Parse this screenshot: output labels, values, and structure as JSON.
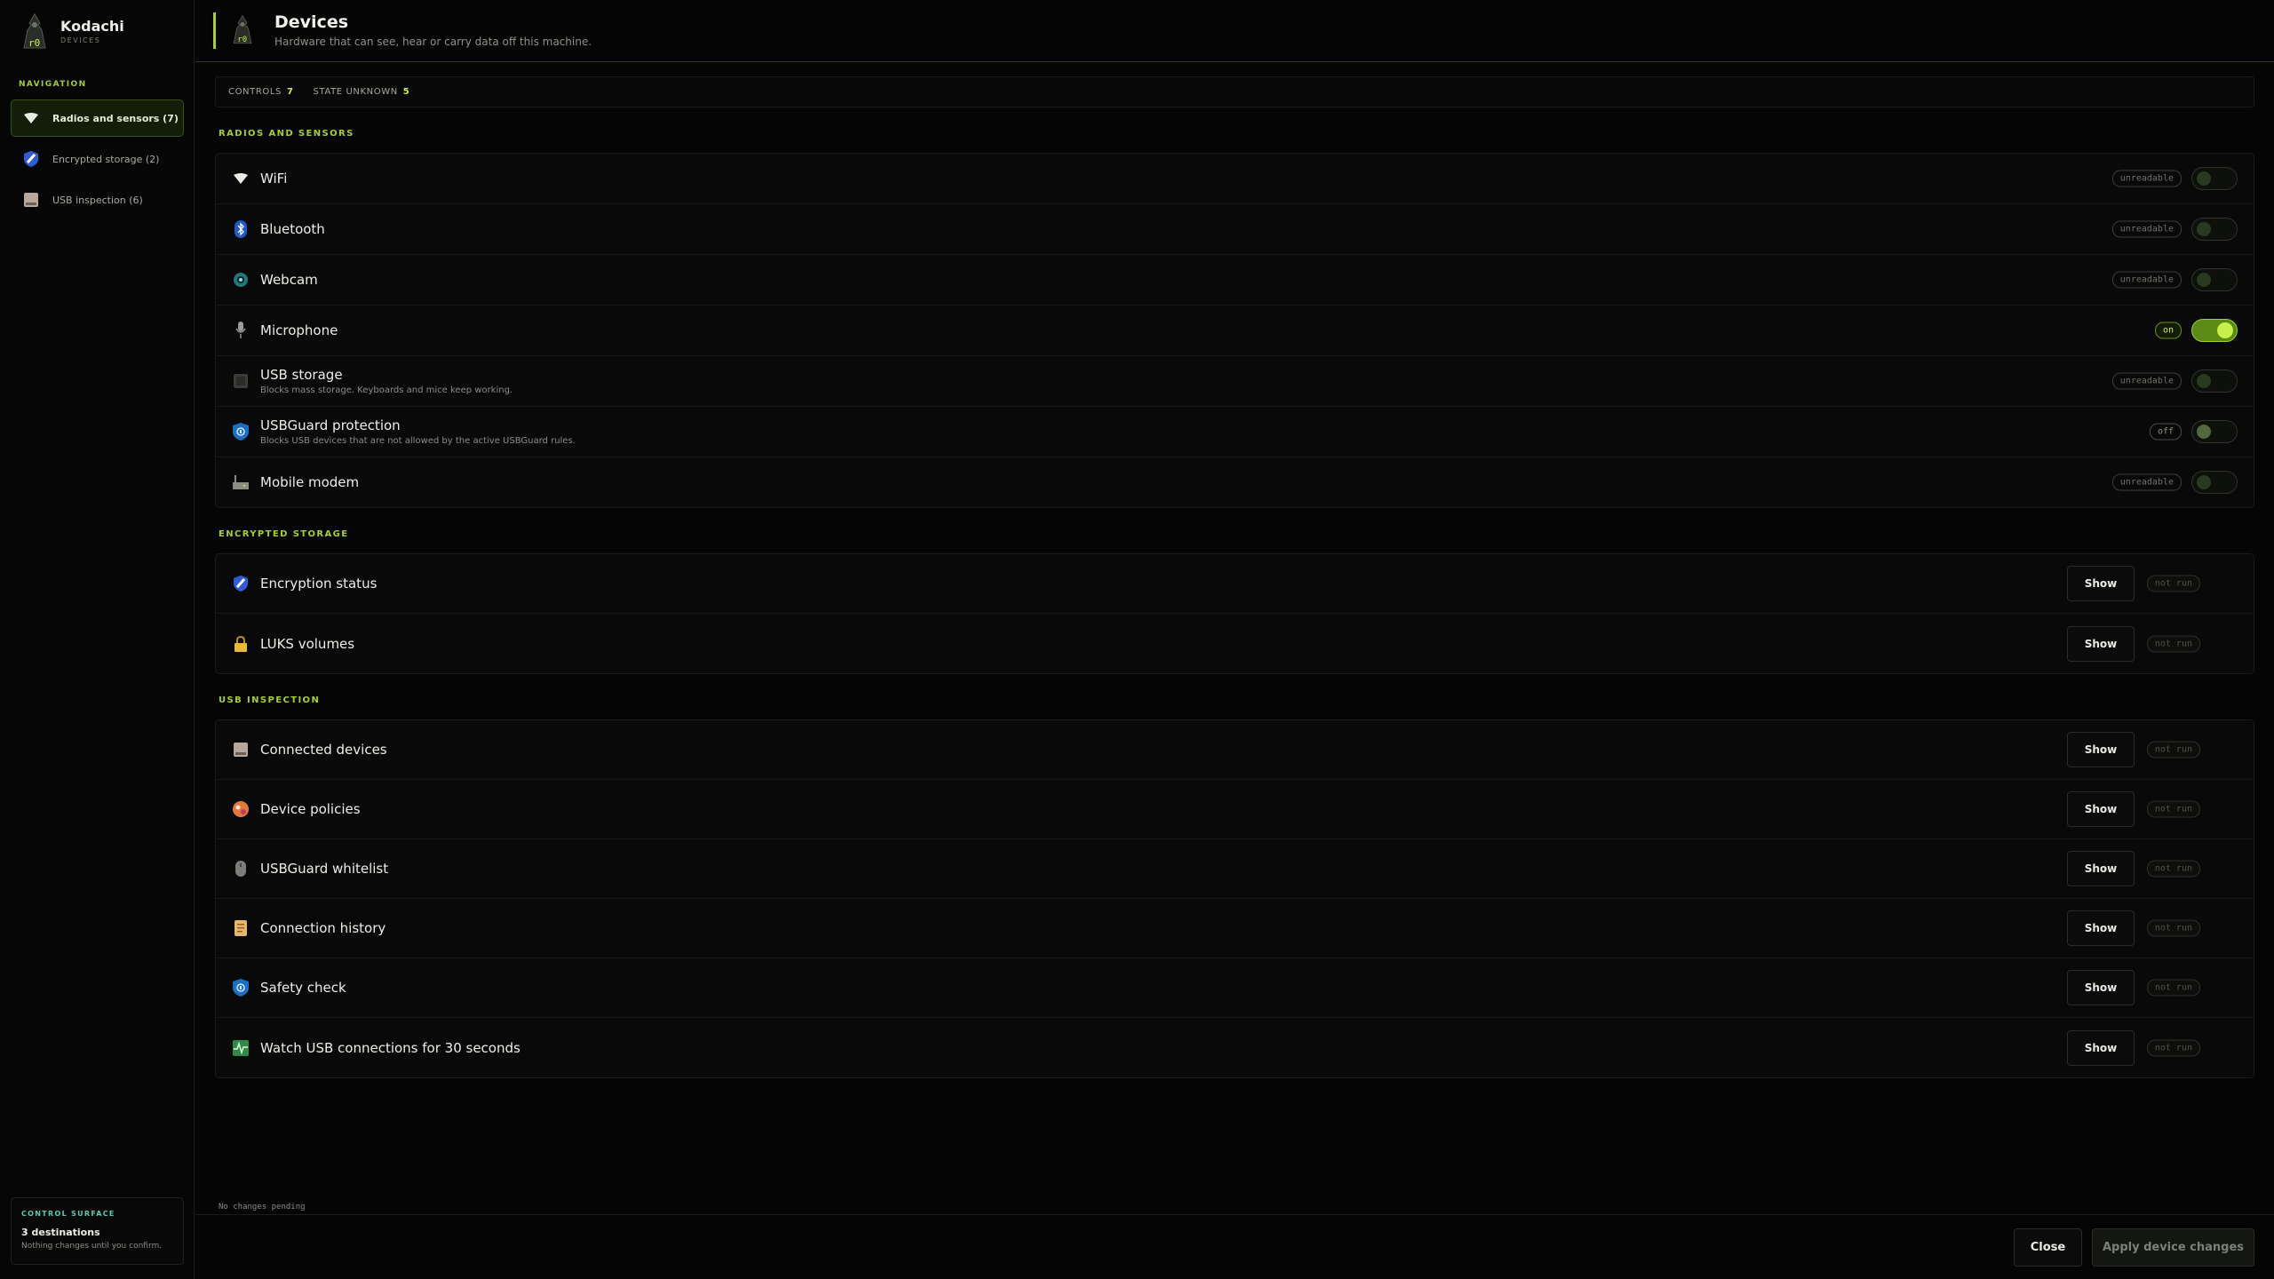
{
  "app": {
    "name": "Kodachi",
    "subtitle": "DEVICES"
  },
  "sidebar": {
    "heading": "NAVIGATION",
    "items": [
      {
        "label": "Radios and sensors (7)",
        "icon": "wifi-icon",
        "active": true
      },
      {
        "label": "Encrypted storage (2)",
        "icon": "shield-icon",
        "active": false
      },
      {
        "label": "USB inspection (6)",
        "icon": "drive-icon",
        "active": false
      }
    ],
    "control_surface": {
      "heading": "CONTROL SURFACE",
      "title": "3 destinations",
      "subtitle": "Nothing changes until you confirm."
    }
  },
  "header": {
    "title": "Devices",
    "subtitle": "Hardware that can see, hear or carry data off this machine."
  },
  "stats": {
    "controls_label": "CONTROLS",
    "controls_value": "7",
    "unknown_label": "STATE UNKNOWN",
    "unknown_value": "5"
  },
  "radios": {
    "title": "RADIOS AND SENSORS",
    "rows": [
      {
        "label": "WiFi",
        "status": "unreadable",
        "icon": "wifi-icon"
      },
      {
        "label": "Bluetooth",
        "status": "unreadable",
        "icon": "bluetooth-icon"
      },
      {
        "label": "Webcam",
        "status": "unreadable",
        "icon": "webcam-icon"
      },
      {
        "label": "Microphone",
        "status": "on",
        "icon": "microphone-icon"
      },
      {
        "label": "USB storage",
        "desc": "Blocks mass storage. Keyboards and mice keep working.",
        "status": "unreadable",
        "icon": "usb-storage-icon"
      },
      {
        "label": "USBGuard protection",
        "desc": "Blocks USB devices that are not allowed by the active USBGuard rules.",
        "status": "off",
        "icon": "shield-lock-icon"
      },
      {
        "label": "Mobile modem",
        "status": "unreadable",
        "icon": "modem-icon"
      }
    ]
  },
  "encrypted": {
    "title": "ENCRYPTED STORAGE",
    "rows": [
      {
        "label": "Encryption status",
        "button": "Show",
        "status": "not run",
        "icon": "shield-icon"
      },
      {
        "label": "LUKS volumes",
        "button": "Show",
        "status": "not run",
        "icon": "lock-icon"
      }
    ]
  },
  "usb": {
    "title": "USB INSPECTION",
    "rows": [
      {
        "label": "Connected devices",
        "button": "Show",
        "status": "not run",
        "icon": "drive-icon"
      },
      {
        "label": "Device policies",
        "button": "Show",
        "status": "not run",
        "icon": "policy-icon"
      },
      {
        "label": "USBGuard whitelist",
        "button": "Show",
        "status": "not run",
        "icon": "mouse-icon"
      },
      {
        "label": "Connection history",
        "button": "Show",
        "status": "not run",
        "icon": "scroll-icon"
      },
      {
        "label": "Safety check",
        "button": "Show",
        "status": "not run",
        "icon": "shield-lock-icon"
      },
      {
        "label": "Watch USB connections for 30 seconds",
        "button": "Show",
        "status": "not run",
        "icon": "pulse-icon"
      }
    ]
  },
  "footer": {
    "pending": "No changes pending",
    "close_label": "Close",
    "apply_label": "Apply device changes"
  },
  "colors": {
    "accent": "#a3d02c",
    "toggle_on": "#c8f04a",
    "teal_heading": "#5fc9b4"
  }
}
